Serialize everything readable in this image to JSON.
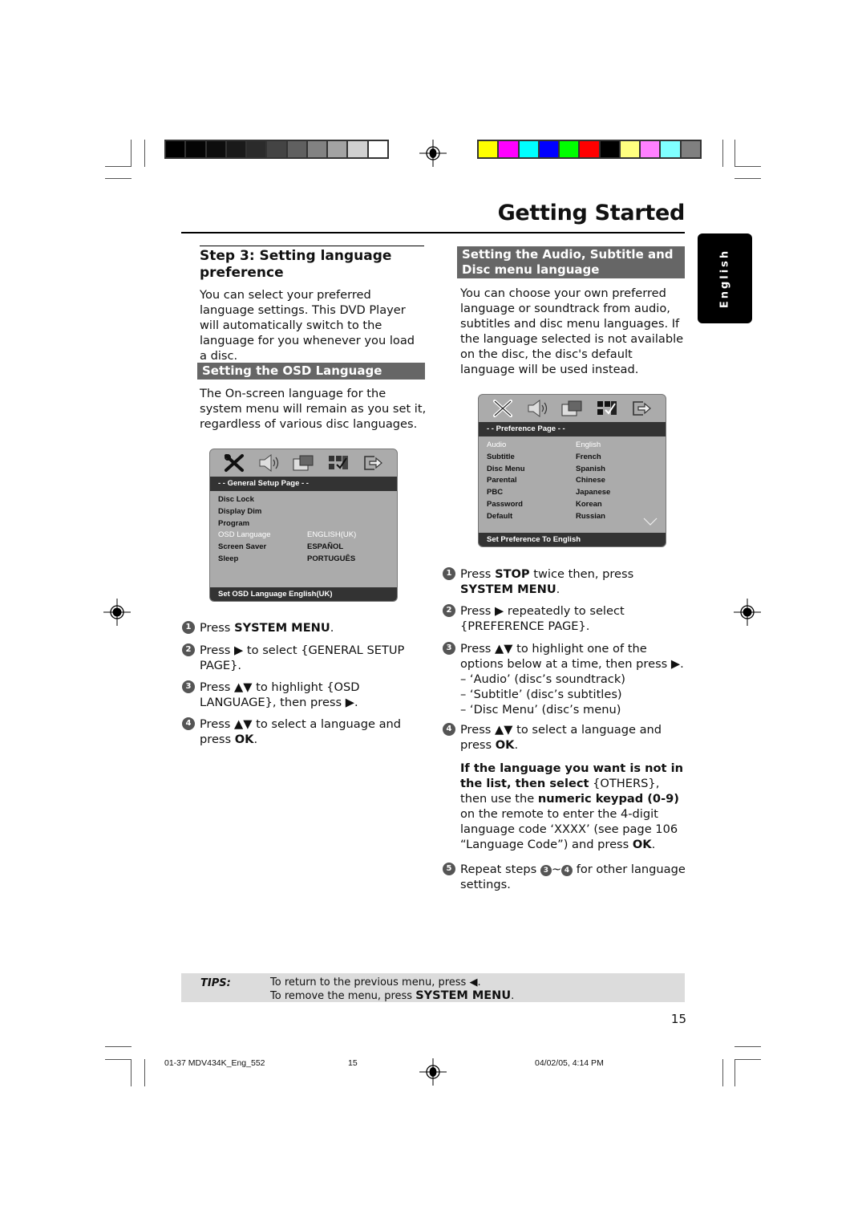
{
  "header": {
    "title": "Getting Started",
    "language_tab": "English"
  },
  "print_marks": {
    "grayscale_swatches": [
      "#000000",
      "#050505",
      "#0d0d0d",
      "#1a1a1a",
      "#2b2b2b",
      "#444444",
      "#606060",
      "#828282",
      "#a3a3a3",
      "#d0d0d0",
      "#ffffff"
    ],
    "color_swatches": [
      "#ffff00",
      "#ff00ff",
      "#00ffff",
      "#0000ff",
      "#00ff00",
      "#ff0000",
      "#000000",
      "#ffff80",
      "#ff80ff",
      "#80ffff",
      "#808080"
    ]
  },
  "left": {
    "step_title": "Step 3:  Setting language preference",
    "intro": "You can select your preferred language settings. This DVD Player will automatically switch to the language for you whenever you load a disc.",
    "section_title": "Setting the OSD Language",
    "section_text": "The On-screen language for the system menu will remain as you set it, regardless of various disc languages.",
    "osd": {
      "header": "- -   General Setup Page   - -",
      "rows": [
        {
          "label": "Disc Lock",
          "value": ""
        },
        {
          "label": "Display Dim",
          "value": ""
        },
        {
          "label": "Program",
          "value": ""
        },
        {
          "label": "OSD Language",
          "value": "ENGLISH(UK)",
          "selected": true
        },
        {
          "label": "Screen Saver",
          "value": "ESPAÑOL"
        },
        {
          "label": "Sleep",
          "value": "PORTUGUÊS"
        }
      ],
      "footer": "Set OSD Language English(UK)"
    },
    "steps": [
      {
        "num": "1",
        "parts": [
          "Press ",
          "SYSTEM MENU",
          "."
        ]
      },
      {
        "num": "2",
        "text": "Press ▶ to select {GENERAL SETUP PAGE}."
      },
      {
        "num": "3",
        "text": "Press ▲▼ to highlight {OSD LANGUAGE}, then press ▶."
      },
      {
        "num": "4",
        "parts": [
          "Press ▲▼  to select a language and press ",
          "OK",
          "."
        ]
      }
    ]
  },
  "right": {
    "section_title": "Setting the Audio, Subtitle and Disc menu language",
    "intro": "You can choose your own preferred language or soundtrack from audio, subtitles and disc menu languages. If the language selected is not available on the disc, the disc's default language will be used instead.",
    "osd": {
      "header": "- -   Preference Page   - -",
      "rows": [
        {
          "label": "Audio",
          "value": "English",
          "selected": true
        },
        {
          "label": "Subtitle",
          "value": "French"
        },
        {
          "label": "Disc Menu",
          "value": "Spanish"
        },
        {
          "label": "Parental",
          "value": "Chinese"
        },
        {
          "label": "PBC",
          "value": "Japanese"
        },
        {
          "label": "Password",
          "value": "Korean"
        },
        {
          "label": "Default",
          "value": "Russian"
        }
      ],
      "footer": "Set Preference To English"
    },
    "steps": [
      {
        "num": "1",
        "parts": [
          "Press ",
          "STOP",
          " twice then, press ",
          "SYSTEM MENU",
          "."
        ]
      },
      {
        "num": "2",
        "text": "Press ▶ repeatedly to select {PREFERENCE PAGE}."
      },
      {
        "num": "3",
        "text": "Press ▲▼  to highlight one of the options below at a time, then press ▶.",
        "sub": [
          "–  ‘Audio’ (disc’s soundtrack)",
          "–  ‘Subtitle’ (disc’s subtitles)",
          "–  ‘Disc Menu’ (disc’s menu)"
        ]
      },
      {
        "num": "4",
        "parts": [
          "Press ▲▼  to select a language and press ",
          "OK",
          "."
        ]
      },
      {
        "num": "5",
        "parts": [
          "Repeat steps ",
          "3",
          "~",
          "4",
          " for other language settings."
        ]
      }
    ],
    "note": {
      "bold1": "If the language you want is not in the list, then select",
      "plain1": " {OTHERS},",
      "plain2": "then use the ",
      "bold2": "numeric keypad (0-9)",
      "plain3": " on the remote to enter the 4-digit language code ‘XXXX’ (see page 106 “Language Code”) and press ",
      "bold3": "OK",
      "plain4": "."
    }
  },
  "tips": {
    "label": "TIPS:",
    "line1": "To return to the previous menu, press ◀.",
    "line2_prefix": "To remove the menu, press ",
    "line2_bold": "SYSTEM MENU",
    "line2_suffix": "."
  },
  "page_number": "15",
  "footer": {
    "file": "01-37 MDV434K_Eng_552",
    "page": "15",
    "timestamp": "04/02/05, 4:14 PM"
  }
}
